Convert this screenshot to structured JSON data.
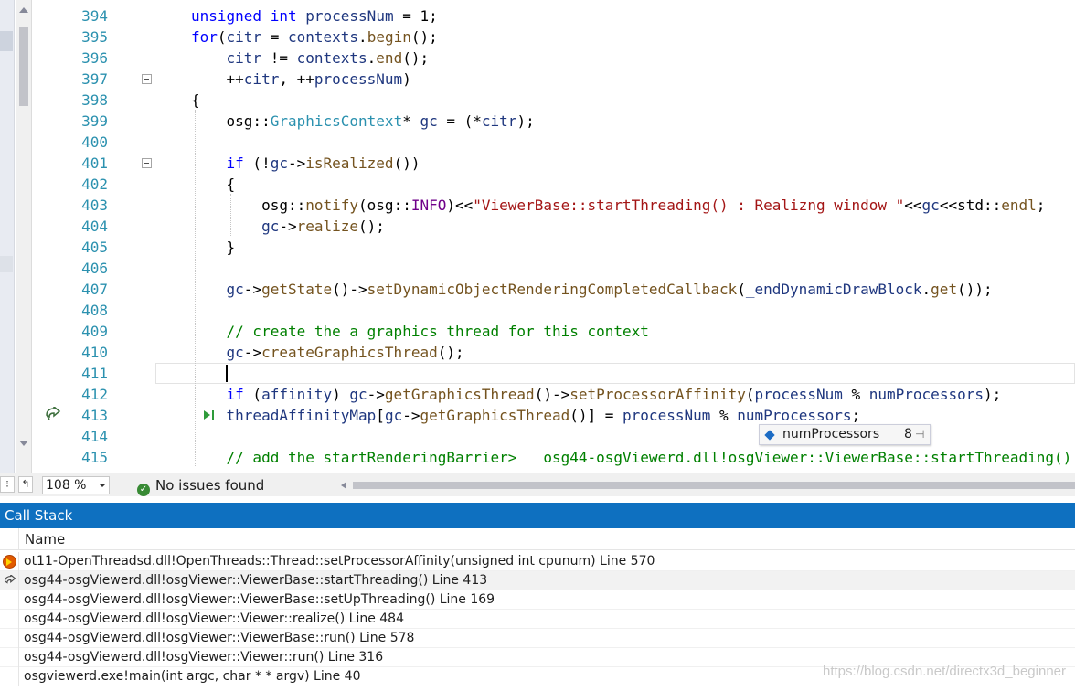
{
  "editor": {
    "lines": [
      {
        "num": "394",
        "code": "unsigned int processNum = 1;"
      },
      {
        "num": "395",
        "code": "for(citr = contexts.begin();"
      },
      {
        "num": "396",
        "code": "    citr != contexts.end();"
      },
      {
        "num": "397",
        "code": "    ++citr, ++processNum)"
      },
      {
        "num": "398",
        "code": "{"
      },
      {
        "num": "399",
        "code": "    osg::GraphicsContext* gc = (*citr);"
      },
      {
        "num": "400",
        "code": ""
      },
      {
        "num": "401",
        "code": "    if (!gc->isRealized())"
      },
      {
        "num": "402",
        "code": "    {"
      },
      {
        "num": "403",
        "code": "        osg::notify(osg::INFO)<<\"ViewerBase::startThreading() : Realizng window \"<<gc<<std::endl;"
      },
      {
        "num": "404",
        "code": "        gc->realize();"
      },
      {
        "num": "405",
        "code": "    }"
      },
      {
        "num": "406",
        "code": ""
      },
      {
        "num": "407",
        "code": "    gc->getState()->setDynamicObjectRenderingCompletedCallback(_endDynamicDrawBlock.get());"
      },
      {
        "num": "408",
        "code": ""
      },
      {
        "num": "409",
        "code": "    // create the a graphics thread for this context"
      },
      {
        "num": "410",
        "code": "    gc->createGraphicsThread();"
      },
      {
        "num": "411",
        "code": ""
      },
      {
        "num": "412",
        "code": "    if (affinity) gc->getGraphicsThread()->setProcessorAffinity(processNum % numProcessors);"
      },
      {
        "num": "413",
        "code": "    threadAffinityMap[gc->getGraphicsThread()] = processNum % numProcessors;"
      },
      {
        "num": "414",
        "code": ""
      },
      {
        "num": "415",
        "code": "    // add the startRenderingBarrier>   osg44-osgViewerd.dll!osgViewer::ViewerBase::startThreading()"
      }
    ],
    "datatip": {
      "name": "numProcessors",
      "value": "8"
    }
  },
  "status": {
    "zoom": "108 %",
    "issues": "No issues found"
  },
  "callstack": {
    "title": "Call Stack",
    "column": "Name",
    "frames": [
      "ot11-OpenThreadsd.dll!OpenThreads::Thread::setProcessorAffinity(unsigned int cpunum) Line 570",
      "osg44-osgViewerd.dll!osgViewer::ViewerBase::startThreading() Line 413",
      "osg44-osgViewerd.dll!osgViewer::ViewerBase::setUpThreading() Line 169",
      "osg44-osgViewerd.dll!osgViewer::Viewer::realize() Line 484",
      "osg44-osgViewerd.dll!osgViewer::ViewerBase::run() Line 578",
      "osg44-osgViewerd.dll!osgViewer::Viewer::run() Line 316",
      "osgviewerd.exe!main(int argc, char * * argv) Line 40"
    ],
    "watermark": "https://blog.csdn.net/directx3d_beginner"
  }
}
